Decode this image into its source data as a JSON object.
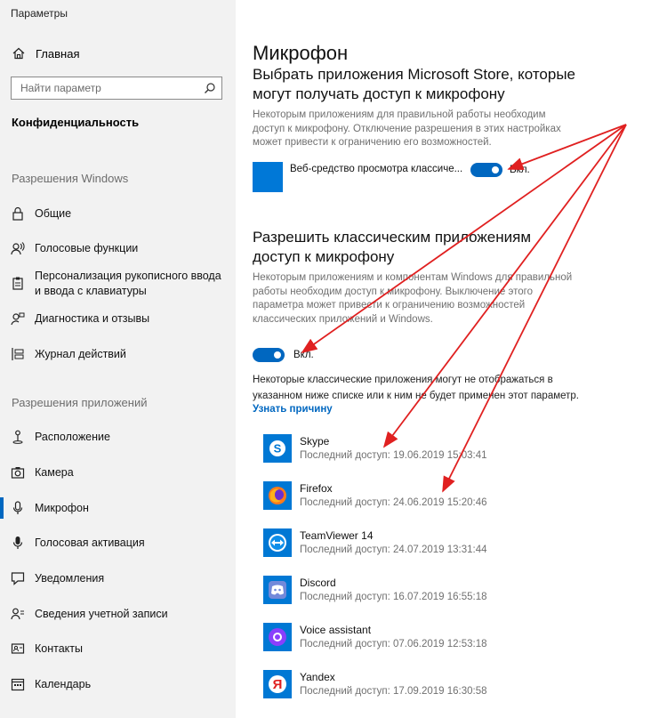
{
  "window": {
    "title": "Параметры"
  },
  "sidebar": {
    "home_label": "Главная",
    "search_placeholder": "Найти параметр",
    "category_title": "Конфиденциальность",
    "windows_section": "Разрешения Windows",
    "windows_items": [
      {
        "label": "Общие",
        "icon": "lock-icon"
      },
      {
        "label": "Голосовые функции",
        "icon": "speech-icon"
      },
      {
        "label": "Персонализация рукописного ввода и ввода с клавиатуры",
        "icon": "clipboard-icon"
      },
      {
        "label": "Диагностика и отзывы",
        "icon": "feedback-icon"
      },
      {
        "label": "Журнал действий",
        "icon": "timeline-icon"
      }
    ],
    "apps_section": "Разрешения приложений",
    "apps_items": [
      {
        "label": "Расположение",
        "icon": "location-icon"
      },
      {
        "label": "Камера",
        "icon": "camera-icon"
      },
      {
        "label": "Микрофон",
        "icon": "microphone-icon",
        "active": true
      },
      {
        "label": "Голосовая активация",
        "icon": "voice-activation-icon"
      },
      {
        "label": "Уведомления",
        "icon": "notification-icon"
      },
      {
        "label": "Сведения учетной записи",
        "icon": "account-icon"
      },
      {
        "label": "Контакты",
        "icon": "contacts-icon"
      },
      {
        "label": "Календарь",
        "icon": "calendar-icon"
      }
    ]
  },
  "main": {
    "page_title": "Микрофон",
    "store_heading": "Выбрать приложения Microsoft Store, которые могут получать доступ к микрофону",
    "store_desc": "Некоторым приложениям для правильной работы необходим доступ к микрофону. Отключение разрешения в этих настройках может привести к ограничению его возможностей.",
    "store_app_name": "Веб-средство просмотра классиче...",
    "store_toggle_label": "Вкл.",
    "classic_heading": "Разрешить классическим приложениям доступ к микрофону",
    "classic_desc": "Некоторым приложениям и компонентам Windows для правильной работы необходим доступ к микрофону. Выключение этого параметра может привести к ограничению возможностей классических приложений и Windows.",
    "classic_toggle_label": "Вкл.",
    "classic_note": "Некоторые классические приложения могут не отображаться в указанном ниже списке или к ним не будет применен этот параметр.",
    "reason_link": "Узнать причину",
    "apps": [
      {
        "name": "Skype",
        "last_access": "Последний доступ: 19.06.2019 15:03:41",
        "icon": "skype-icon",
        "color": "#0078d4"
      },
      {
        "name": "Firefox",
        "last_access": "Последний доступ: 24.06.2019 15:20:46",
        "icon": "firefox-icon",
        "color": "#0078d4"
      },
      {
        "name": "TeamViewer 14",
        "last_access": "Последний доступ: 24.07.2019 13:31:44",
        "icon": "teamviewer-icon",
        "color": "#0078d4"
      },
      {
        "name": "Discord",
        "last_access": "Последний доступ: 16.07.2019 16:55:18",
        "icon": "discord-icon",
        "color": "#0078d4"
      },
      {
        "name": "Voice assistant",
        "last_access": "Последний доступ: 07.06.2019 12:53:18",
        "icon": "alice-icon",
        "color": "#0078d4"
      },
      {
        "name": "Yandex",
        "last_access": "Последний доступ: 17.09.2019 16:30:58",
        "icon": "yandex-icon",
        "color": "#0078d4"
      }
    ]
  },
  "colors": {
    "accent": "#0067c0",
    "annotation": "#e02020",
    "sidebar_bg": "#f2f2f2"
  }
}
